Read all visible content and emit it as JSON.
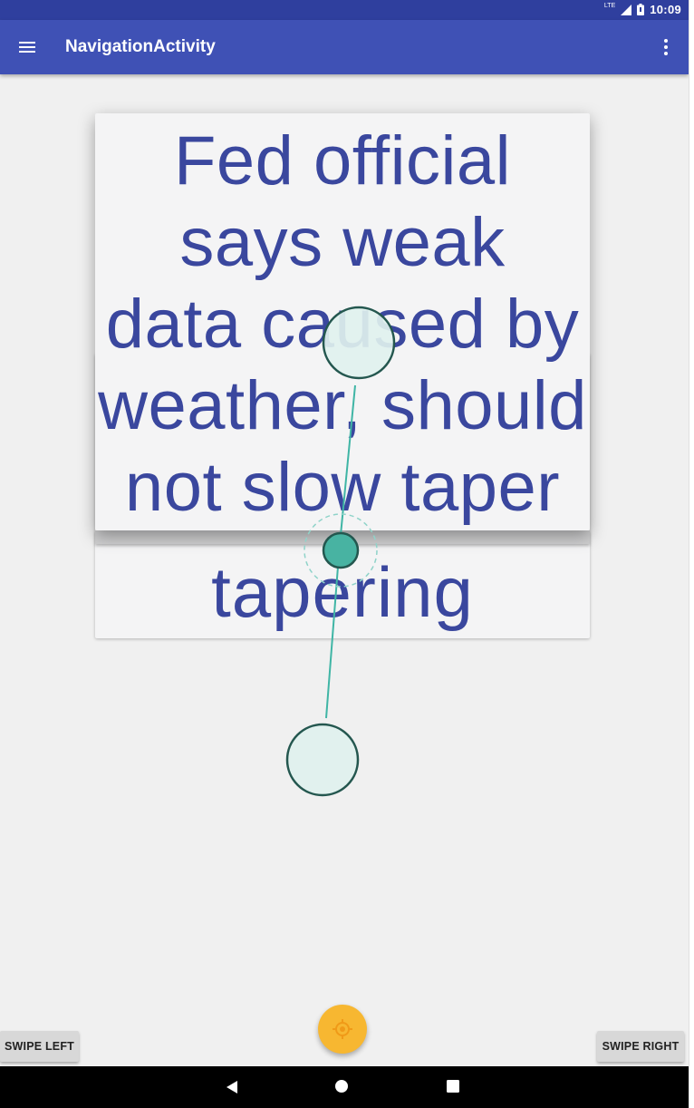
{
  "status_bar": {
    "network": "LTE",
    "time": "10:09"
  },
  "toolbar": {
    "title": "NavigationActivity",
    "menu_icon": "hamburger-menu-icon",
    "overflow_icon": "more-vert-icon"
  },
  "cards": {
    "front_text": "Fed official says weak data caused by weather, should not slow taper",
    "front_lines": [
      "Fed official",
      "says weak",
      "data caused by",
      "weather, should",
      "not slow taper"
    ],
    "back_text_visible": "tapering"
  },
  "buttons": {
    "swipe_left": "SWIPE LEFT",
    "swipe_right": "SWIPE RIGHT"
  },
  "fab": {
    "icon": "target-icon",
    "color": "#f7b731"
  },
  "colors": {
    "primary": "#3f51b5",
    "primary_dark": "#2f3f9e",
    "card_text": "#3a479e",
    "touch_indicator": "#3fb5a5"
  },
  "nav_bar": {
    "back_icon": "back-triangle-icon",
    "home_icon": "home-circle-icon",
    "recents_icon": "recents-square-icon"
  }
}
